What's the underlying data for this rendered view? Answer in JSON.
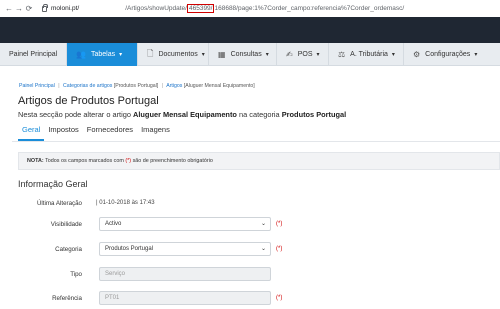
{
  "browser": {
    "back": "←",
    "forward": "→",
    "reload": "⟳",
    "host": "moloni.pt/",
    "path_before": "/Artigos/showUpdate/",
    "path_highlight": "465399/",
    "path_after": "168688/page:1%7Corder_campo:referencia%7Corder_ordemasc/"
  },
  "nav": {
    "items": [
      {
        "label": "Painel Principal",
        "icon": "",
        "chevron": ""
      },
      {
        "label": "Tabelas",
        "icon": "👥",
        "chevron": "▾"
      },
      {
        "label": "Documentos",
        "icon": "🗋",
        "chevron": "▾"
      },
      {
        "label": "Consultas",
        "icon": "▦",
        "chevron": "▾"
      },
      {
        "label": "POS",
        "icon": "✍",
        "chevron": "▾"
      },
      {
        "label": "A. Tributária",
        "icon": "⚖",
        "chevron": "▾"
      },
      {
        "label": "Configurações",
        "icon": "⚙",
        "chevron": "▾"
      }
    ]
  },
  "breadcrumb": {
    "home": "Painel Principal",
    "sep": "|",
    "level2": "Categorias de artigos",
    "level2_suffix": "[Produtos Portugal]",
    "level3": "Artigos",
    "level3_suffix": "[Aluguer Mensal Equipamento]"
  },
  "page": {
    "title": "Artigos de Produtos Portugal",
    "subtitle_pre": "Nesta secção pode alterar o artigo ",
    "subtitle_item": "Aluguer Mensal Equipamento",
    "subtitle_mid": " na categoria ",
    "subtitle_cat": "Produtos Portugal"
  },
  "tabs": [
    "Geral",
    "Impostos",
    "Fornecedores",
    "Imagens"
  ],
  "note": {
    "label": "NOTA:",
    "text_pre": " Todos os campos marcados com ",
    "mark": "(*)",
    "text_post": " são de preenchimento obrigatório"
  },
  "section": {
    "title": "Informação Geral"
  },
  "form": {
    "last_change_label": "Última Alteração",
    "last_change_value": "| 01-10-2018 às 17:43",
    "visibility_label": "Visibilidade",
    "visibility_value": "Activo",
    "category_label": "Categoria",
    "category_value": "Produtos Portugal",
    "type_label": "Tipo",
    "type_value": "Serviço",
    "reference_label": "Referência",
    "reference_value": "PT01",
    "required_mark": "(*)",
    "caret": "⌄"
  },
  "colors": {
    "accent": "#1a8dd9",
    "dark_band": "#1f2733",
    "required": "#d00000",
    "url_highlight": "#d00000"
  }
}
